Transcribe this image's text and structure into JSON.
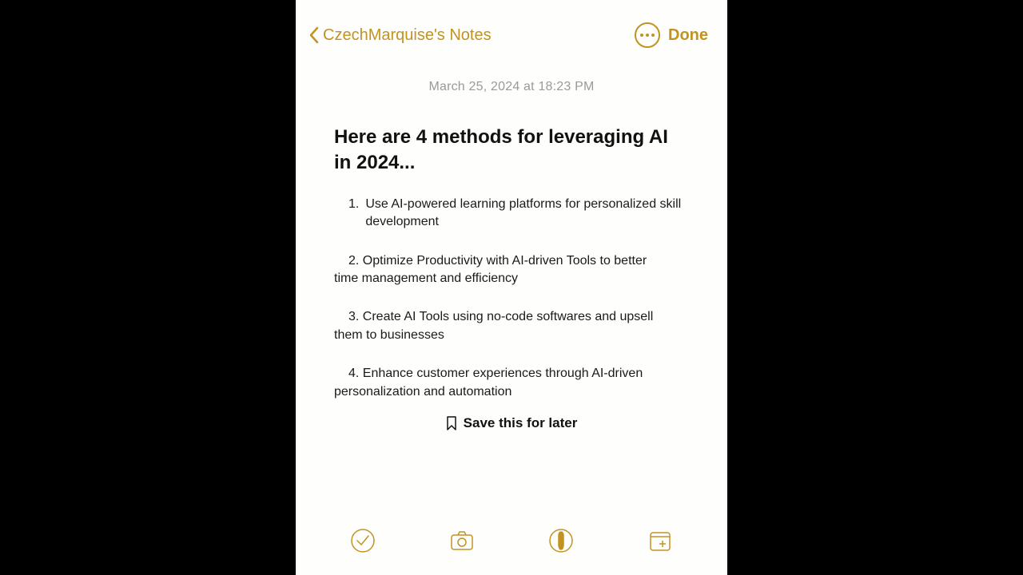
{
  "header": {
    "back_label": "CzechMarquise's Notes",
    "done_label": "Done"
  },
  "timestamp": "March 25, 2024 at 18:23 PM",
  "note": {
    "title": "Here are 4 methods for leveraging AI in 2024...",
    "items": [
      {
        "num": "1.",
        "text": "Use AI-powered learning platforms for personalized skill development"
      },
      {
        "lead": "   2. Optimize Productivity with AI-driven Tools to better",
        "rest": "time management and efficiency"
      },
      {
        "lead": "   3. Create AI Tools using no-code softwares and upsell",
        "rest": "them to businesses"
      },
      {
        "lead": "   4. Enhance customer experiences through AI-driven",
        "rest": "personalization and automation"
      }
    ],
    "save_label": "Save this for later"
  },
  "toolbar": {
    "check": "checkmark",
    "camera": "camera",
    "draw": "marker",
    "new": "new-note"
  }
}
